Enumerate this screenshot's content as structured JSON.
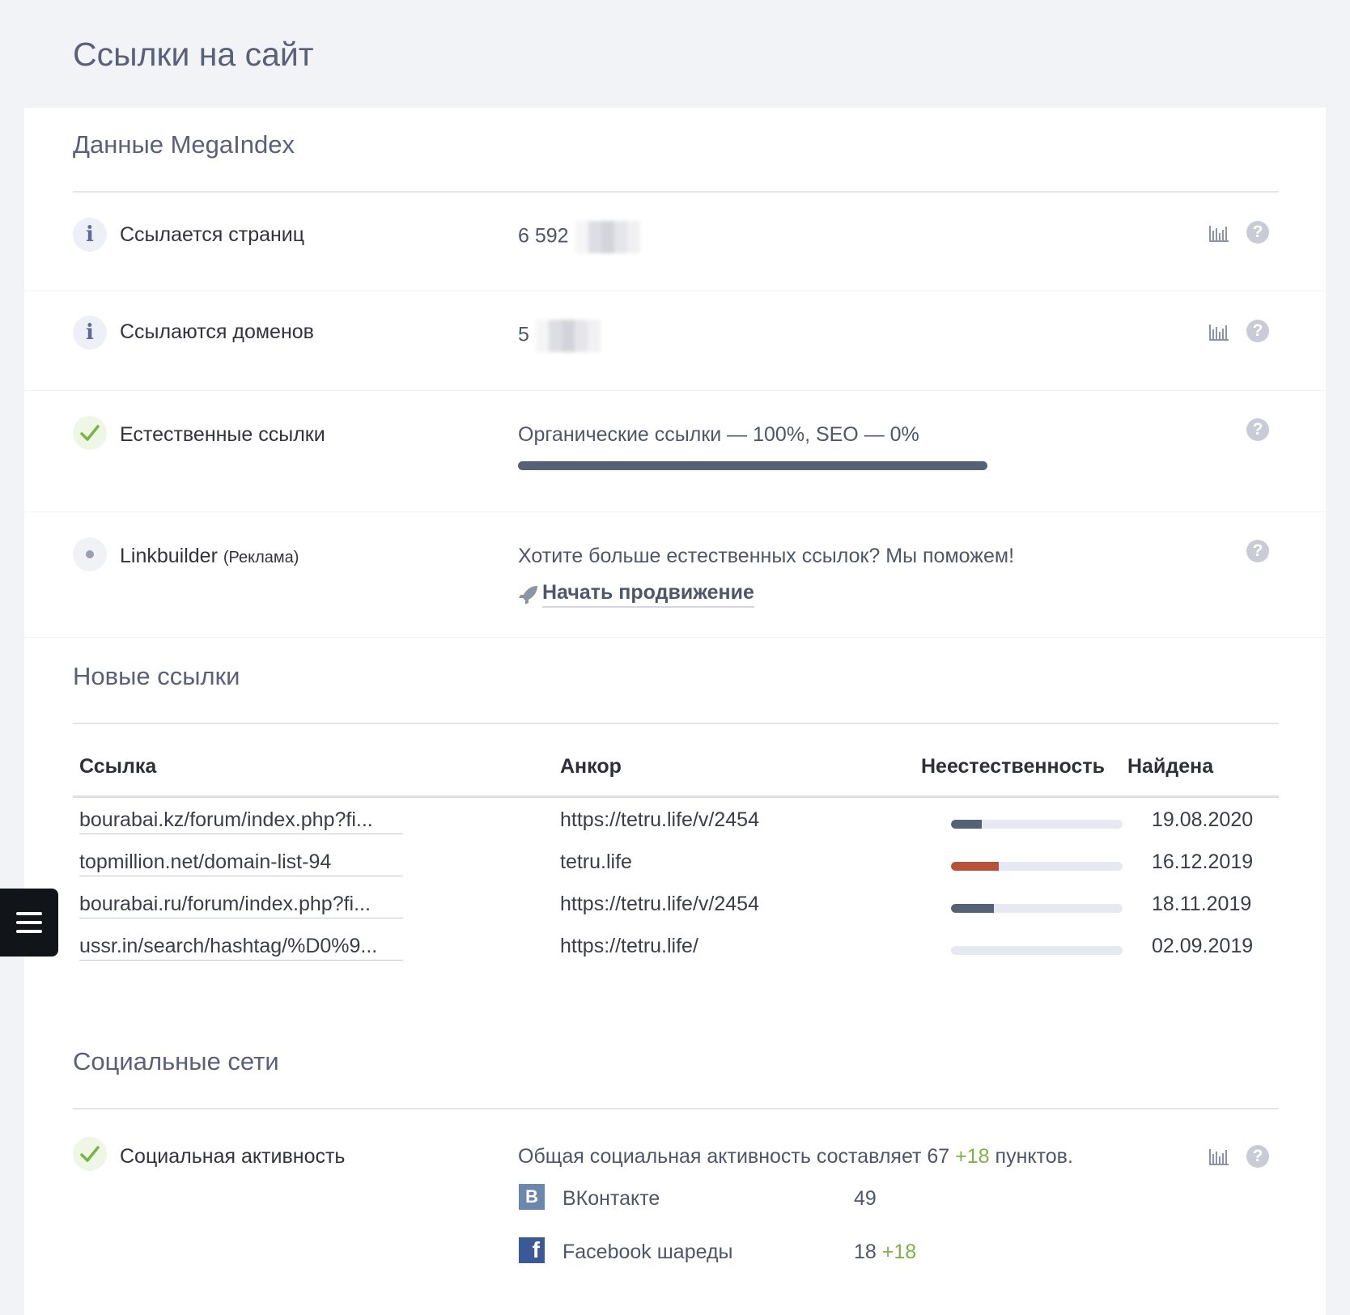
{
  "page": {
    "title": "Ссылки на сайт"
  },
  "megaindex": {
    "title": "Данные MegaIndex",
    "rows": {
      "pages": {
        "label": "Ссылается страниц",
        "value": "6 592"
      },
      "domains": {
        "label": "Ссылаются доменов",
        "value": "5"
      },
      "natural": {
        "label": "Естественные ссылки",
        "value": "Органические ссылки — 100%, SEO — 0%",
        "organic_fraction": 1.0
      },
      "linkbuilder": {
        "label": "Linkbuilder",
        "label_note": "(Реклама)",
        "text": "Хотите больше естественных ссылок? Мы поможем!",
        "action": "Начать продвижение"
      }
    }
  },
  "new_links": {
    "title": "Новые ссылки",
    "columns": {
      "link": "Ссылка",
      "anchor": "Анкор",
      "unnatural": "Неестественность",
      "found": "Найдена"
    },
    "rows": [
      {
        "link": "bourabai.kz/forum/index.php?fi...",
        "anchor": "https://tetru.life/v/2454",
        "unnatural": 0.18,
        "bar_color": "#556275",
        "found": "19.08.2020"
      },
      {
        "link": "topmillion.net/domain-list-94",
        "anchor": "tetru.life",
        "unnatural": 0.28,
        "bar_color": "#b8513a",
        "found": "16.12.2019"
      },
      {
        "link": "bourabai.ru/forum/index.php?fi...",
        "anchor": "https://tetru.life/v/2454",
        "unnatural": 0.25,
        "bar_color": "#556275",
        "found": "18.11.2019"
      },
      {
        "link": "ussr.in/search/hashtag/%D0%9...",
        "anchor": "https://tetru.life/",
        "unnatural": 0.0,
        "bar_color": "#556275",
        "found": "02.09.2019"
      }
    ]
  },
  "social": {
    "title": "Социальные сети",
    "label": "Социальная активность",
    "summary_prefix": "Общая социальная активность составляет 67",
    "summary_delta": "+18",
    "summary_suffix": "пунктов.",
    "networks": [
      {
        "icon": "vk-icon",
        "glyph": "B",
        "name": "ВКонтакте",
        "count": "49",
        "delta": "",
        "color": "#6b87ad"
      },
      {
        "icon": "facebook-icon",
        "glyph": "f",
        "name": "Facebook шареды",
        "count": "18",
        "delta": "+18",
        "color": "#3b5998"
      }
    ]
  },
  "colors": {
    "accent_green": "#7cb342",
    "bar_dark": "#556275",
    "bar_red": "#b8513a"
  }
}
